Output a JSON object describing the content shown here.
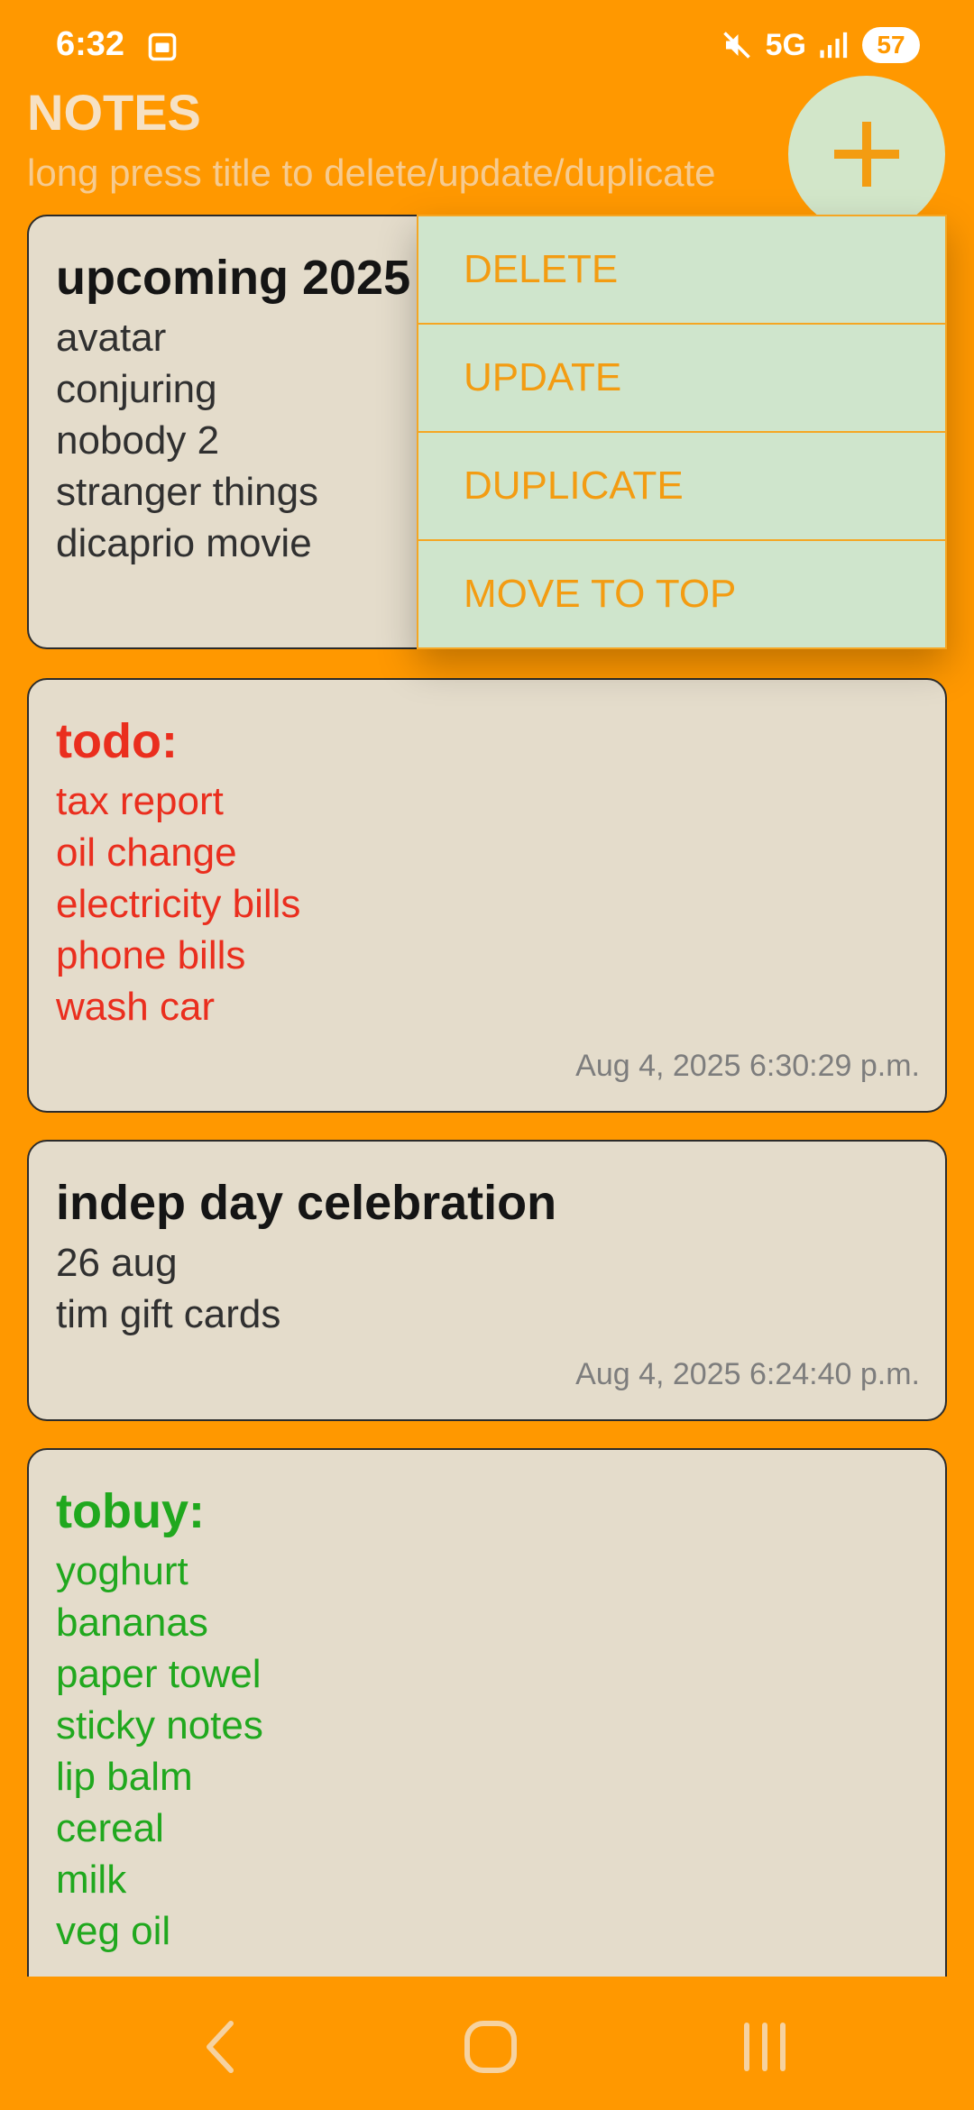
{
  "status": {
    "time": "6:32",
    "network": "5G",
    "battery": "57"
  },
  "header": {
    "title": "NOTES",
    "subtitle": "long press title to delete/update/duplicate"
  },
  "notes": [
    {
      "title": "upcoming 2025",
      "lines": [
        "avatar",
        "conjuring",
        "nobody 2",
        "stranger things",
        "dicaprio movie"
      ]
    },
    {
      "title": "todo:",
      "lines": [
        "tax report",
        "oil change",
        "electricity bills",
        "phone bills",
        "wash car"
      ],
      "date": "Aug 4, 2025 6:30:29 p.m."
    },
    {
      "title": "indep day celebration",
      "lines": [
        "26 aug",
        "tim gift cards"
      ],
      "date": "Aug 4, 2025 6:24:40 p.m."
    },
    {
      "title": "tobuy:",
      "lines": [
        "yoghurt",
        "bananas",
        "paper towel",
        "sticky notes",
        "lip balm",
        "cereal",
        "milk",
        "veg oil"
      ]
    }
  ],
  "menu": {
    "delete": "DELETE",
    "update": "UPDATE",
    "duplicate": "DUPLICATE",
    "move_to_top": "MOVE TO TOP"
  },
  "colors": {
    "background": "#FF9800",
    "card": "#E4DCCB",
    "menu_item": "#CFE5CC",
    "menu_text": "#F39C12",
    "todo": "#EA2E1E",
    "tobuy": "#20A81E"
  },
  "icons": {
    "fab": "plus-icon",
    "nav_back": "back-icon",
    "nav_home": "home-icon",
    "nav_recents": "recents-icon"
  }
}
